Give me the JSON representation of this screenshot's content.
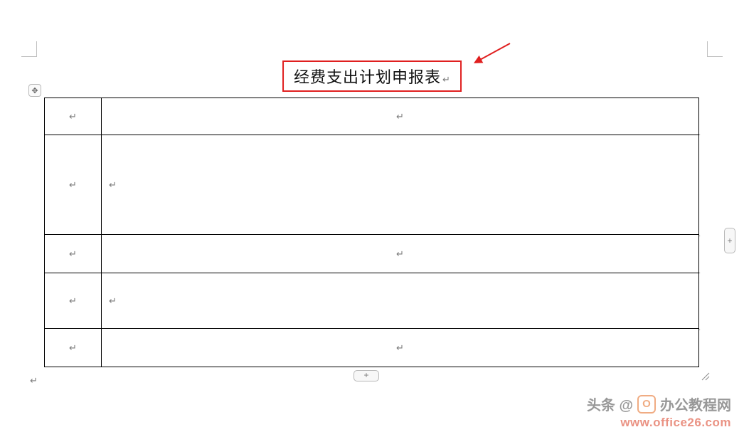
{
  "title": "经费支出计划申报表",
  "paragraph_mark": "↵",
  "handles": {
    "move": "✥",
    "insert_col": "+",
    "insert_row": "+",
    "resize": "↘"
  },
  "table": {
    "rows": [
      {
        "cells": [
          "↵",
          "↵"
        ],
        "centered": [
          true,
          true
        ]
      },
      {
        "cells": [
          "↵",
          "↵"
        ],
        "centered": [
          true,
          false
        ]
      },
      {
        "cells": [
          "↵",
          "↵"
        ],
        "centered": [
          true,
          true
        ]
      },
      {
        "cells": [
          "↵",
          "↵"
        ],
        "centered": [
          true,
          false
        ]
      },
      {
        "cells": [
          "↵",
          "↵"
        ],
        "centered": [
          true,
          true
        ]
      }
    ]
  },
  "watermark": {
    "line1_prefix": "头条 @",
    "line1_brand": "办公教程网",
    "url": "www.office26.com",
    "logo_letter": "O"
  }
}
